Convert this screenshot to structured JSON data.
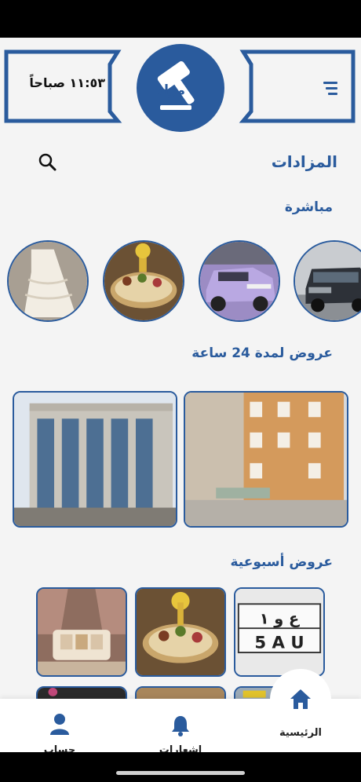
{
  "header": {
    "time": "١١:٥٣ صباحاً",
    "logo_text": "مزاد",
    "menu_icon": "menu-icon"
  },
  "page": {
    "title": "المزادات"
  },
  "sections": {
    "live": "مباشرة",
    "offers_24h": "عروض لمدة 24 ساعة",
    "weekly": "عروض أسبوعية"
  },
  "live_items": [
    {
      "image": "car-dark-suv"
    },
    {
      "image": "car-lavender-suv"
    },
    {
      "image": "gold-table-decor"
    },
    {
      "image": "white-dress"
    }
  ],
  "offers_24h_items": [
    {
      "image": "building-stone"
    },
    {
      "image": "building-glass"
    }
  ],
  "weekly_items": [
    {
      "image": "license-plate",
      "plate_top": "ع و ١",
      "plate_bottom": "5 A U"
    },
    {
      "image": "gold-table-decor"
    },
    {
      "image": "ornate-sofa"
    }
  ],
  "nav": {
    "home": "الرئيسية",
    "notifications": "اشعارات",
    "account": "حساب"
  },
  "colors": {
    "brand": "#2a5b9d",
    "background": "#f4f4f4"
  }
}
